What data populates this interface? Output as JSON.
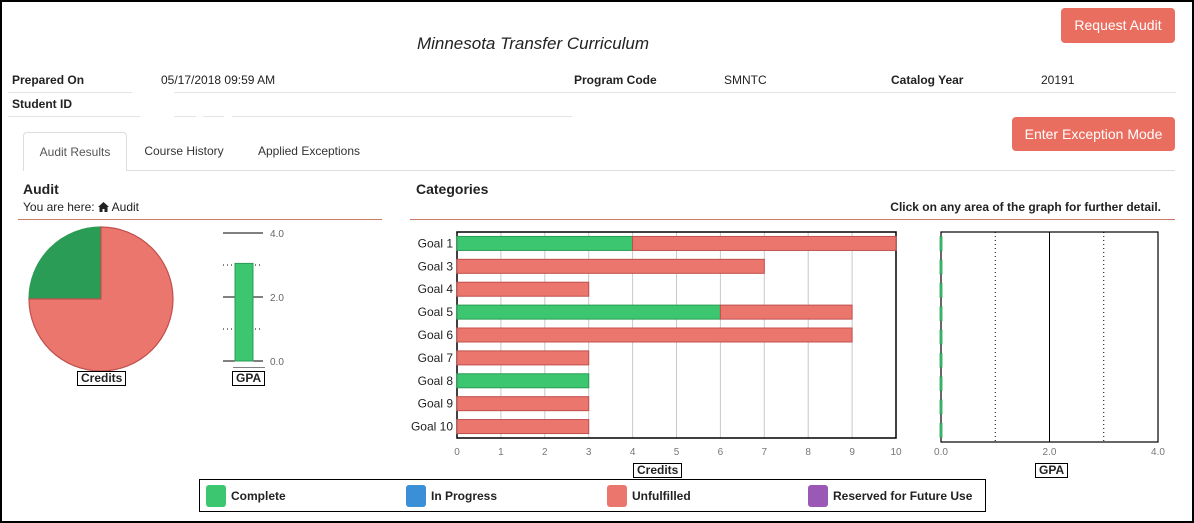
{
  "header": {
    "title": "Minnesota Transfer Curriculum",
    "request_audit_label": "Request Audit",
    "exception_mode_label": "Enter Exception Mode"
  },
  "info": {
    "prepared_on_label": "Prepared On",
    "prepared_on_value": "05/17/2018 09:59 AM",
    "program_code_label": "Program Code",
    "program_code_value": "SMNTC",
    "catalog_year_label": "Catalog Year",
    "catalog_year_value": "20191",
    "student_id_label": "Student ID",
    "student_id_value": ""
  },
  "tabs": [
    {
      "label": "Audit Results",
      "active": true
    },
    {
      "label": "Course History",
      "active": false
    },
    {
      "label": "Applied Exceptions",
      "active": false
    }
  ],
  "audit": {
    "title": "Audit",
    "breadcrumb_prefix": "You are here:",
    "breadcrumb_item": "Audit",
    "home_icon": "home-icon"
  },
  "categories": {
    "title": "Categories",
    "hint": "Click on any area of the graph for further detail."
  },
  "colors": {
    "complete": "#3cc66f",
    "complete_dark": "#2a9c55",
    "in_progress": "#3a8fd6",
    "unfulfilled": "#eb766d",
    "reserved": "#9b59b6"
  },
  "legend": [
    {
      "label": "Complete",
      "color": "#3cc66f"
    },
    {
      "label": "In Progress",
      "color": "#3a8fd6"
    },
    {
      "label": "Unfulfilled",
      "color": "#eb766d"
    },
    {
      "label": "Reserved for Future Use",
      "color": "#9b59b6"
    }
  ],
  "chart_data": [
    {
      "type": "pie",
      "title": "Credits",
      "slices": [
        {
          "label": "Complete",
          "value": 25
        },
        {
          "label": "Unfulfilled",
          "value": 75
        }
      ]
    },
    {
      "type": "bar",
      "title": "GPA",
      "values": [
        3.05
      ],
      "ylim": [
        0,
        4.0
      ],
      "ticks": [
        "0.0",
        "2.0",
        "4.0"
      ]
    },
    {
      "type": "bar",
      "orientation": "horizontal",
      "stacked": true,
      "xlabel": "Credits",
      "xlim": [
        0,
        10
      ],
      "xticks": [
        "0",
        "1",
        "2",
        "3",
        "4",
        "5",
        "6",
        "7",
        "8",
        "9",
        "10"
      ],
      "grid": true,
      "categories": [
        "Goal 1",
        "Goal 3",
        "Goal 4",
        "Goal 5",
        "Goal 6",
        "Goal 7",
        "Goal 8",
        "Goal 9",
        "Goal 10"
      ],
      "series": [
        {
          "name": "Complete",
          "values": [
            4,
            0,
            0,
            6,
            0,
            0,
            3,
            0,
            0
          ]
        },
        {
          "name": "Unfulfilled",
          "values": [
            6,
            7,
            3,
            3,
            9,
            3,
            0,
            3,
            3
          ]
        }
      ]
    },
    {
      "type": "bar",
      "orientation": "horizontal",
      "xlabel": "GPA",
      "xlim": [
        0,
        4.0
      ],
      "xticks": [
        "0.0",
        "2.0",
        "4.0"
      ],
      "categories": [
        "Goal 1",
        "Goal 3",
        "Goal 4",
        "Goal 5",
        "Goal 6",
        "Goal 7",
        "Goal 8",
        "Goal 9",
        "Goal 10"
      ],
      "values": [
        0,
        0,
        0,
        0,
        0,
        0,
        0,
        0,
        0
      ]
    }
  ]
}
